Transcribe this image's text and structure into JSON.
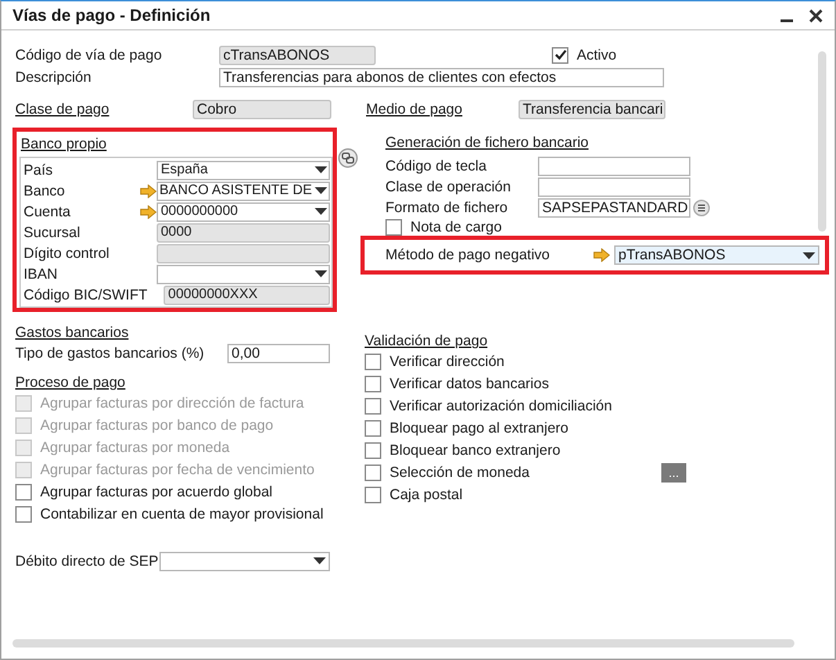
{
  "window": {
    "title": "Vías de pago - Definición"
  },
  "header": {
    "fields": [
      {
        "label": "Código de vía de pago",
        "value": "cTransABONOS",
        "kind": "readonly"
      },
      {
        "label": "Descripción",
        "value": "Transferencias para abonos de clientes con efectos",
        "kind": "text"
      }
    ],
    "active": {
      "label": "Activo",
      "checked": true
    }
  },
  "payment_class": {
    "label": "Clase de pago",
    "value": "Cobro"
  },
  "payment_medium": {
    "label": "Medio de pago",
    "value": "Transferencia bancari"
  },
  "own_bank": {
    "title": "Banco propio",
    "highlighted": true,
    "fields": [
      {
        "label": "País",
        "value": "España",
        "kind": "dropdown",
        "arrow": false
      },
      {
        "label": "Banco",
        "value": "BANCO ASISTENTE DE",
        "kind": "dropdown",
        "arrow": true
      },
      {
        "label": "Cuenta",
        "value": "0000000000",
        "kind": "dropdown",
        "arrow": true
      },
      {
        "label": "Sucursal",
        "value": "0000",
        "kind": "readonly",
        "arrow": false
      },
      {
        "label": "Dígito control",
        "kind": "readonly",
        "arrow": false
      },
      {
        "label": "IBAN",
        "kind": "dropdown",
        "arrow": false
      },
      {
        "label": "Código BIC/SWIFT",
        "value": "00000000XXX",
        "kind": "readonly",
        "arrow": false
      }
    ]
  },
  "file_generation": {
    "title": "Generación de fichero bancario",
    "fields": [
      {
        "label": "Código de tecla",
        "kind": "text"
      },
      {
        "label": "Clase de operación",
        "kind": "text"
      },
      {
        "label": "Formato de fichero",
        "value": "SAPSEPASTANDARD",
        "kind": "list"
      }
    ],
    "debit_note": {
      "label": "Nota de cargo",
      "checked": false
    },
    "negative_method": {
      "label": "Método de pago negativo",
      "value": "pTransABONOS",
      "arrow": true,
      "highlighted": true
    }
  },
  "bank_charges": {
    "title": "Gastos bancarios",
    "label": "Tipo de gastos bancarios (%)",
    "value": "0,00"
  },
  "payment_process": {
    "title": "Proceso de pago",
    "options": [
      {
        "label": "Agrupar facturas por dirección de factura",
        "checked": false,
        "disabled": true
      },
      {
        "label": "Agrupar facturas por banco de pago",
        "checked": false,
        "disabled": true
      },
      {
        "label": "Agrupar facturas por moneda",
        "checked": false,
        "disabled": true
      },
      {
        "label": "Agrupar facturas por fecha de vencimiento",
        "checked": false,
        "disabled": true
      },
      {
        "label": "Agrupar facturas por acuerdo global",
        "checked": false,
        "disabled": false
      },
      {
        "label": "Contabilizar en cuenta de mayor provisional",
        "checked": false,
        "disabled": false
      }
    ]
  },
  "validation": {
    "title": "Validación de pago",
    "options": [
      {
        "label": "Verificar dirección",
        "checked": false
      },
      {
        "label": "Verificar datos bancarios",
        "checked": false
      },
      {
        "label": "Verificar autorización domiciliación",
        "checked": false
      },
      {
        "label": "Bloquear pago al extranjero",
        "checked": false
      },
      {
        "label": "Bloquear banco extranjero",
        "checked": false
      },
      {
        "label": "Selección de moneda",
        "checked": false,
        "button": "..."
      },
      {
        "label": "Caja postal",
        "checked": false
      }
    ]
  },
  "sep_debit": {
    "label": "Débito directo de SEP",
    "kind": "dropdown"
  }
}
